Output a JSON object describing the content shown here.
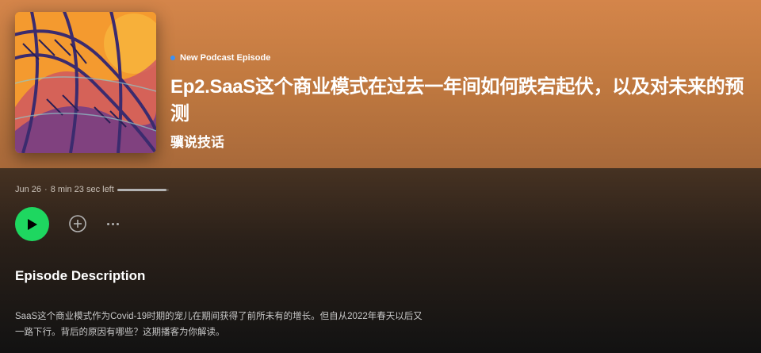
{
  "episode": {
    "type_label": "New Podcast Episode",
    "title": "Ep2.SaaS这个商业模式在过去一年间如何跌宕起伏，以及对未来的预测",
    "show_name": "骥说技话",
    "date": "Jun 26",
    "separator": "·",
    "time_left": "8 min 23 sec left",
    "progress_fraction": 0.05
  },
  "controls": {
    "play_icon": "play-icon",
    "add_icon": "add-circle-icon",
    "more_icon": "more-options-icon"
  },
  "description": {
    "heading": "Episode Description",
    "body": "SaaS这个商业模式作为Covid-19时期的宠儿在期间获得了前所未有的增长。但自从2022年春天以后又一路下行。背后的原因有哪些？这期播客为你解读。"
  },
  "colors": {
    "accent_green": "#1ed760",
    "header_orange": "#d4854a",
    "badge_blue": "#3d91f4"
  }
}
